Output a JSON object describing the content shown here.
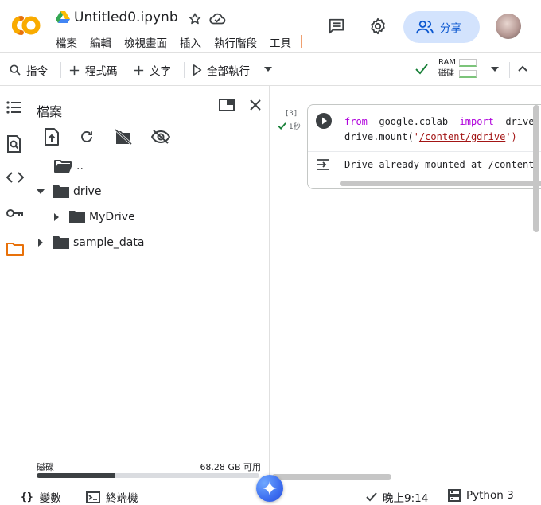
{
  "app": {
    "notebook_title": "Untitled0.ipynb",
    "menu": [
      "檔案",
      "編輯",
      "檢視畫面",
      "插入",
      "執行階段",
      "工具"
    ],
    "share_label": "分享",
    "colors": {
      "logo_orange": "#F9AB00",
      "logo_orange_dark": "#E8710A",
      "share_bg": "#d3e3fd",
      "share_text": "#0b57d0"
    }
  },
  "toolbar": {
    "command_label": "指令",
    "add_code_label": "程式碼",
    "add_text_label": "文字",
    "run_all_label": "全部執行",
    "ram_label": "RAM",
    "disk_label": "磁碟"
  },
  "files_panel": {
    "title": "檔案",
    "tree": [
      {
        "name": "..",
        "depth": 0,
        "expandable": false
      },
      {
        "name": "drive",
        "depth": 0,
        "expandable": true,
        "expanded": true
      },
      {
        "name": "MyDrive",
        "depth": 1,
        "expandable": true,
        "expanded": false
      },
      {
        "name": "sample_data",
        "depth": 0,
        "expandable": true,
        "expanded": false
      }
    ],
    "disk_label": "磁碟",
    "disk_free": "68.28 GB 可用",
    "disk_used_fraction": 0.35
  },
  "cell": {
    "execution_count": "[3]",
    "exec_time": "1秒",
    "code_line1": {
      "kw1": "from",
      "mod": "google.colab",
      "kw2": "import",
      "name": "drive"
    },
    "code_line2": {
      "prefix": "drive.mount(",
      "quote_open": "'",
      "path": "/content/gdrive",
      "quote_close": "')"
    },
    "output": "Drive already mounted at /content/"
  },
  "statusbar": {
    "variables_label": "變數",
    "terminal_label": "終端機",
    "time": "晚上9:14",
    "runtime": "Python 3"
  }
}
